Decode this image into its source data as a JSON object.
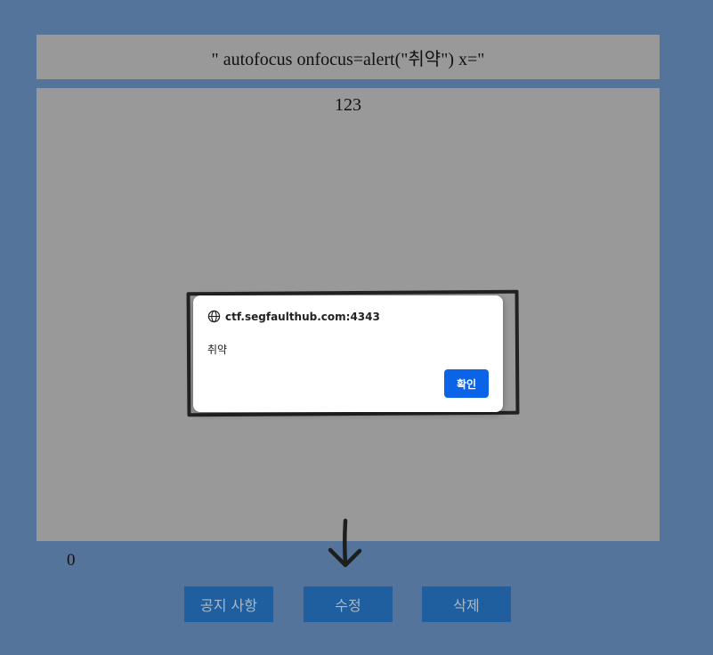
{
  "post": {
    "title": "\" autofocus onfocus=alert(\"취약\") x=\"",
    "content": "123",
    "counter": "0"
  },
  "buttons": {
    "notice_label": "공지 사항",
    "edit_label": "수정",
    "delete_label": "삭제"
  },
  "dialog": {
    "origin": "ctf.segfaulthub.com:4343",
    "message": "취약",
    "ok_label": "확인",
    "icon": "globe-icon"
  },
  "colors": {
    "page_background": "#55749b",
    "panel_background": "#999999",
    "button_background": "#1f5f9f",
    "dialog_ok_background": "#0b63e8"
  }
}
